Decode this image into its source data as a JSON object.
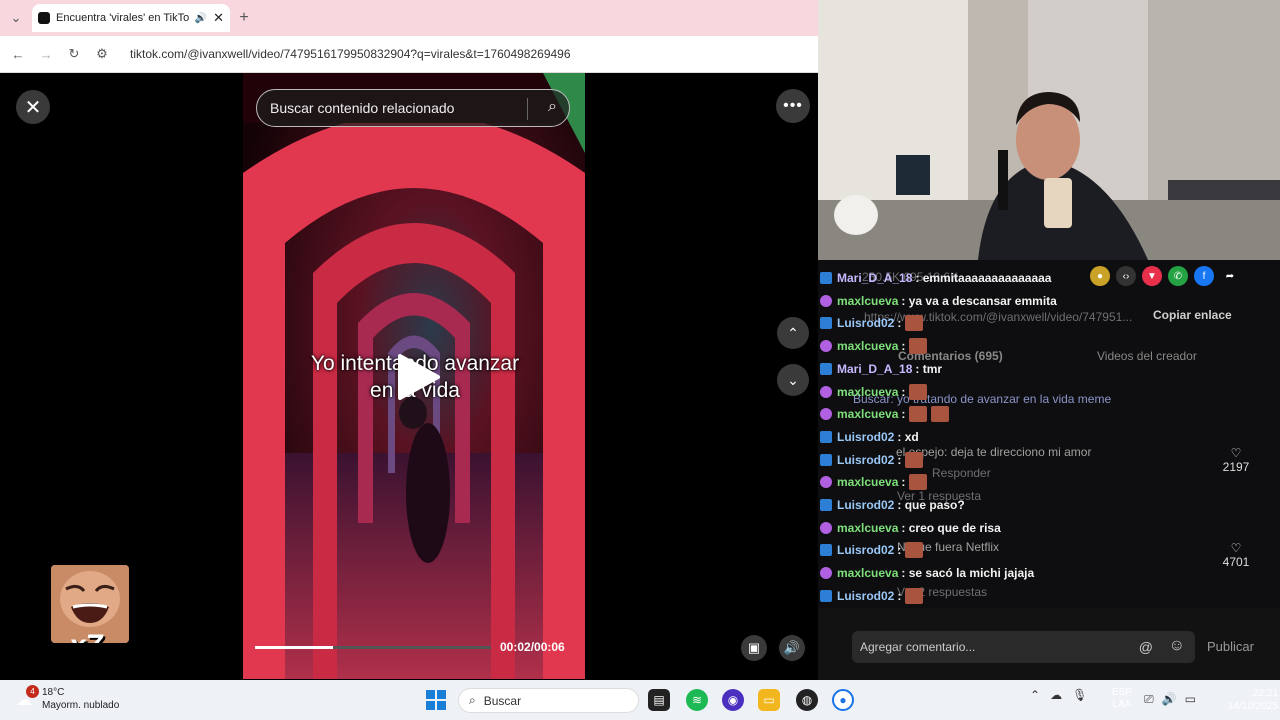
{
  "browser": {
    "tab_title": "Encuentra 'virales' en TikTo",
    "url": "tiktok.com/@ivanxwell/video/7479516179950832904?q=virales&t=1760498269496"
  },
  "tiktok": {
    "search_placeholder": "Buscar contenido relacionado",
    "caption_line1": "Yo intentando avanzar",
    "caption_line2": "en la vida",
    "time": "00:02/00:06",
    "progress": 0.33
  },
  "overlay": {
    "multiplier": "x7"
  },
  "chat": {
    "ghost_url": "https://www.tiktok.com/@ivanxwell/video/747951...",
    "copy_link": "Copiar enlace",
    "ghost_comments_tab": "Comentarios (695)",
    "ghost_creator_tab": "Videos del creador",
    "ghost_search": "Buscar: yo tratando de avanzar en la vida meme",
    "ghost_comment1": "el espejo: deja te direcciono mi amor",
    "ghost_reply": "Responder",
    "ghost_see_reply": "Ver 1 respuesta",
    "ghost_comment2": "Ni que fuera Netflix",
    "ghost_see_replies": "Ver 2 respuestas",
    "like1": "2197",
    "like2": "4701",
    "ghost_stats": "250.5K   695   18.6K",
    "lines": [
      {
        "user": "Mari_D_A_18",
        "text": ": emmitaaaaaaaaaaaaaa",
        "type": "d",
        "emote": 0
      },
      {
        "user": "maxlcueva",
        "text": ": ya va a descansar emmita",
        "type": "m",
        "emote": 0
      },
      {
        "user": "Luisrod02",
        "text": ":",
        "type": "l",
        "emote": 1
      },
      {
        "user": "maxlcueva",
        "text": ":",
        "type": "m",
        "emote": 1
      },
      {
        "user": "Mari_D_A_18",
        "text": ": tmr",
        "type": "d",
        "emote": 0
      },
      {
        "user": "maxlcueva",
        "text": ":",
        "type": "m",
        "emote": 1
      },
      {
        "user": "maxlcueva",
        "text": ":",
        "type": "m",
        "emote": 2
      },
      {
        "user": "Luisrod02",
        "text": ": xd",
        "type": "l",
        "emote": 0
      },
      {
        "user": "Luisrod02",
        "text": ":",
        "type": "l",
        "emote": 1
      },
      {
        "user": "maxlcueva",
        "text": ":",
        "type": "m",
        "emote": 1
      },
      {
        "user": "Luisrod02",
        "text": ": que paso?",
        "type": "l",
        "emote": 0
      },
      {
        "user": "maxlcueva",
        "text": ": creo que de risa",
        "type": "m",
        "emote": 0
      },
      {
        "user": "Luisrod02",
        "text": ":",
        "type": "l",
        "emote": 1
      },
      {
        "user": "maxlcueva",
        "text": ": se sacó la michi jajaja",
        "type": "m",
        "emote": 0
      },
      {
        "user": "Luisrod02",
        "text": ":",
        "type": "l",
        "emote": 1
      }
    ]
  },
  "comment_input": {
    "placeholder": "Agregar comentario...",
    "publish": "Publicar"
  },
  "taskbar": {
    "temp": "18°C",
    "weather": "Mayorm. nublado",
    "weather_badge": "4",
    "search": "Buscar",
    "lang1": "ESP",
    "lang2": "LAA",
    "time": "22:21",
    "date": "14/10/2025"
  }
}
